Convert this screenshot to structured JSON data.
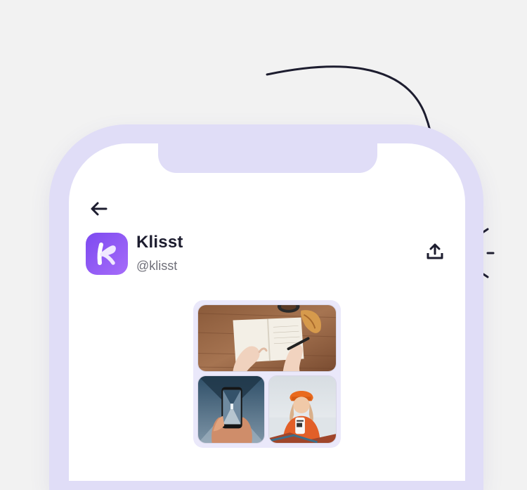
{
  "colors": {
    "background": "#f2f2f2",
    "phone_frame": "#e0ddf7",
    "screen": "#ffffff",
    "ink": "#1d1d2f",
    "muted_text": "#6e6e78",
    "brand_gradient_start": "#7d4af0",
    "brand_gradient_end": "#a66cf9"
  },
  "icons": {
    "back": "arrow-left-icon",
    "share": "share-upload-icon",
    "hint_arrow": "curved-arrow-icon",
    "logo": "klisst-logo-icon"
  },
  "profile": {
    "name": "Klisst",
    "handle": "@klisst",
    "avatar_letter": "k"
  },
  "gallery": {
    "photos": [
      {
        "subject": "notebook-writing-photo"
      },
      {
        "subject": "phone-camera-photo"
      },
      {
        "subject": "woman-orange-beanie-photo"
      }
    ]
  }
}
